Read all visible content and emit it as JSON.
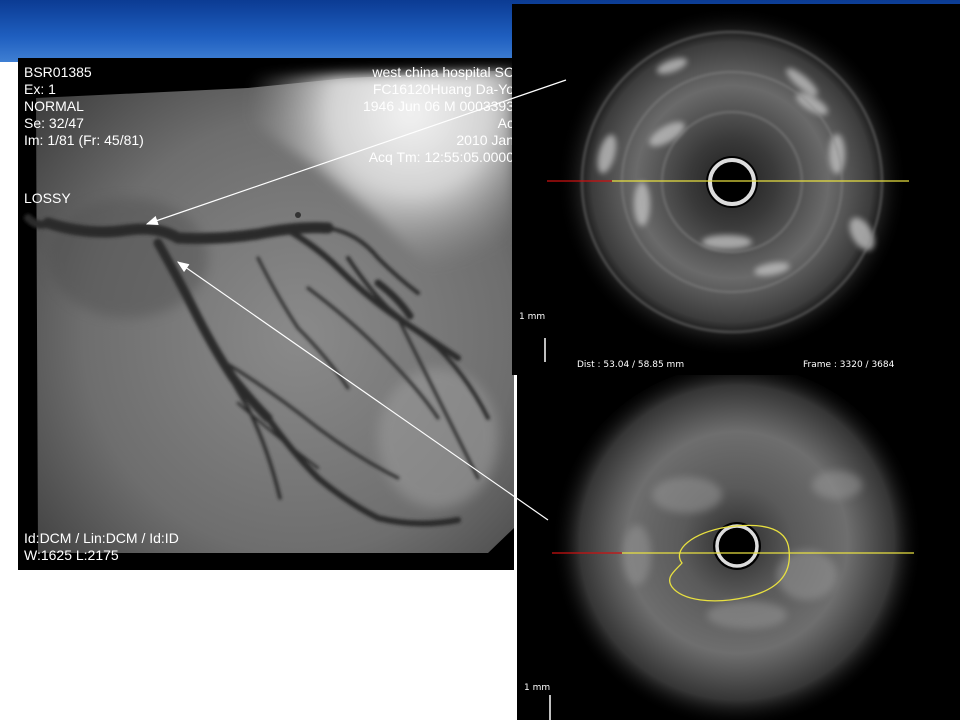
{
  "angiogram": {
    "left_lines": [
      "BSR01385",
      "Ex: 1",
      "NORMAL",
      "Se: 32/47",
      "Im: 1/81 (Fr: 45/81)"
    ],
    "lossy": "LOSSY",
    "right_lines": [
      "west china hospital SC",
      "FC16120Huang Da-Yo",
      "1946 Jun 06  M  0003393",
      "Ac",
      "2010 Jan",
      "Acq Tm: 12:55:05.0000"
    ],
    "bottom_lines": [
      "Id:DCM / Lin:DCM / Id:ID",
      "W:1625  L:2175"
    ]
  },
  "ivus_top": {
    "scale_label": "1 mm",
    "dist": "Dist :  53.04  /  58.85  mm",
    "frame": "Frame : 3320  /  3684"
  },
  "ivus_bottom": {
    "scale_label": "1 mm"
  },
  "colors": {
    "header": "#1f5fc0",
    "guide_red": "#cc1010",
    "guide_yellow": "#e8e040",
    "arrow": "#ffffff"
  }
}
